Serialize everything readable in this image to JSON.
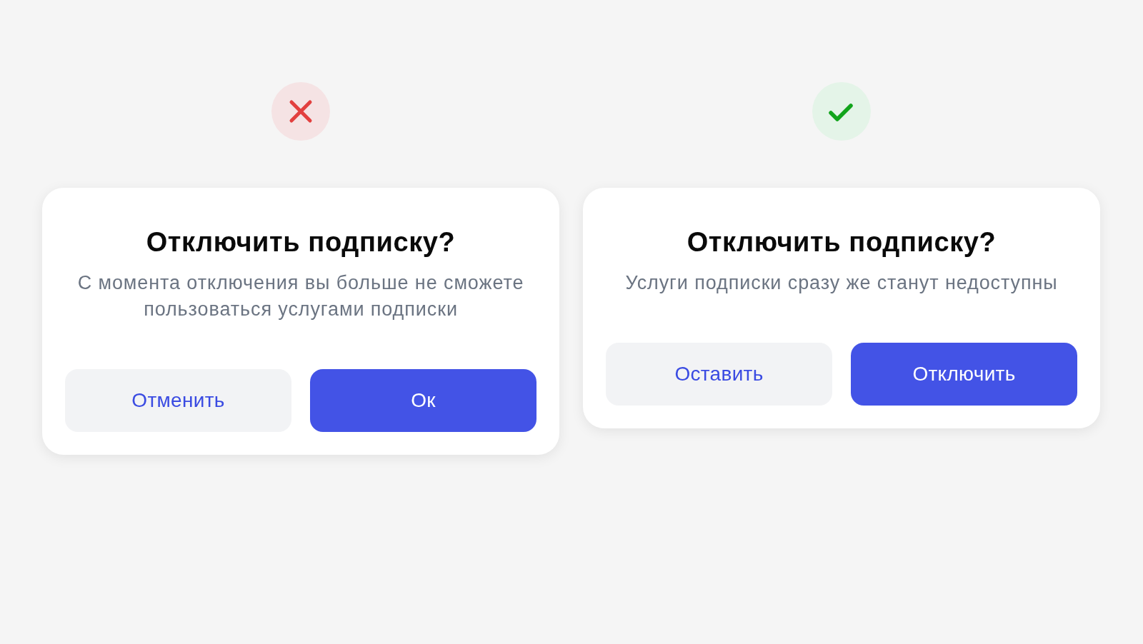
{
  "examples": [
    {
      "kind": "bad",
      "dialog": {
        "title": "Отключить подписку?",
        "message": "С момента отключения вы больше не сможете пользоваться услугами подписки",
        "buttons": [
          {
            "label": "Отменить",
            "kind": "secondary"
          },
          {
            "label": "Ок",
            "kind": "primary"
          }
        ]
      }
    },
    {
      "kind": "good",
      "dialog": {
        "title": "Отключить подписку?",
        "message": "Услуги подписки сразу же станут недоступны",
        "buttons": [
          {
            "label": "Оставить",
            "kind": "secondary"
          },
          {
            "label": "Отключить",
            "kind": "primary"
          }
        ]
      }
    }
  ]
}
